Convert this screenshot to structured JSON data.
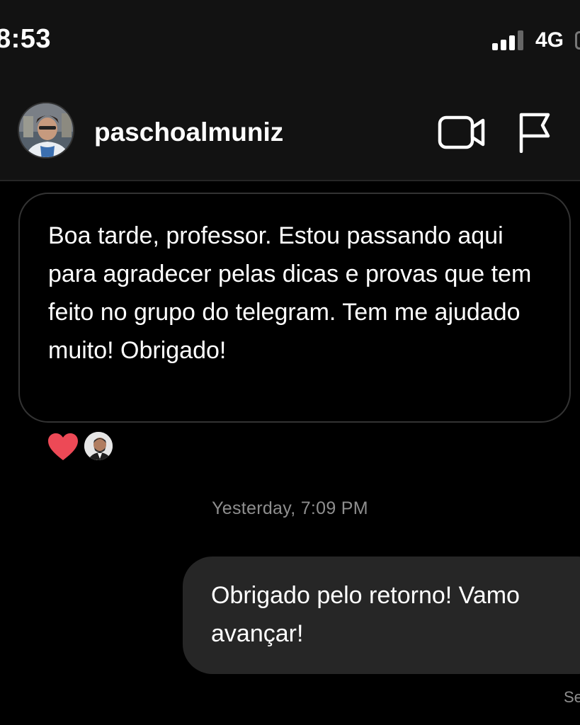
{
  "status_bar": {
    "time": "8:53",
    "network": "4G",
    "icons": [
      "signal-bars-icon",
      "battery-icon"
    ]
  },
  "header": {
    "username": "paschoalmuniz",
    "icons": [
      "profile-avatar",
      "video-call-icon",
      "flag-icon"
    ]
  },
  "messages": [
    {
      "direction": "incoming",
      "text": "Boa tarde, professor. Estou passando aqui para agradecer pelas dicas e provas que tem feito no grupo do telegram. Tem me ajudado muito! Obrigado!",
      "reaction": "heart-reaction-icon"
    },
    {
      "timestamp": "Yesterday, 7:09 PM"
    },
    {
      "direction": "outgoing",
      "line1": "Obrigado pelo retorno! Vamo",
      "line2": "avançar!"
    }
  ],
  "seen_label": "Se",
  "colors": {
    "background": "#000000",
    "header_bg": "#121212",
    "outgoing_bubble": "#262626",
    "secondary_text": "#8e8e8e",
    "heart": "#ed4956"
  }
}
